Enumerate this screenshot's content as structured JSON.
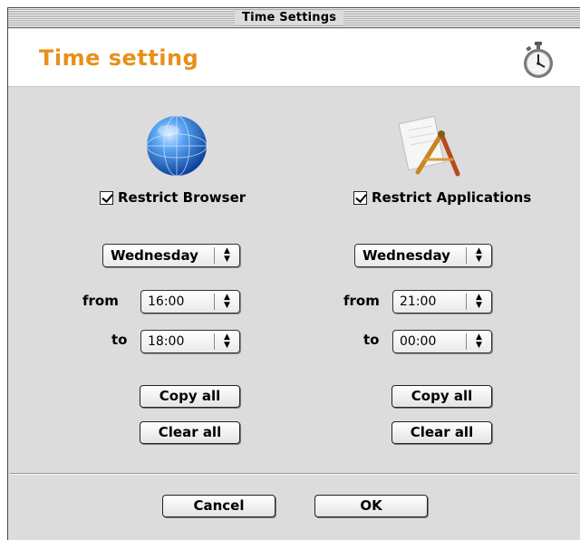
{
  "window": {
    "title": "Time Settings"
  },
  "header": {
    "title": "Time setting",
    "icon": "stopwatch-icon"
  },
  "browser": {
    "icon": "globe-icon",
    "checkbox_label": "Restrict Browser",
    "checked": true,
    "day": "Wednesday",
    "from_label": "from",
    "from_time": "16:00",
    "to_label": "to",
    "to_time": "18:00",
    "copy_label": "Copy all",
    "clear_label": "Clear all"
  },
  "applications": {
    "icon": "applications-icon",
    "checkbox_label": "Restrict Applications",
    "checked": true,
    "day": "Wednesday",
    "from_label": "from",
    "from_time": "21:00",
    "to_label": "to",
    "to_time": "00:00",
    "copy_label": "Copy all",
    "clear_label": "Clear all"
  },
  "footer": {
    "cancel_label": "Cancel",
    "ok_label": "OK"
  },
  "colors": {
    "accent": "#e8901a",
    "globe": "#2f7fe0",
    "background": "#dcdcdc"
  }
}
